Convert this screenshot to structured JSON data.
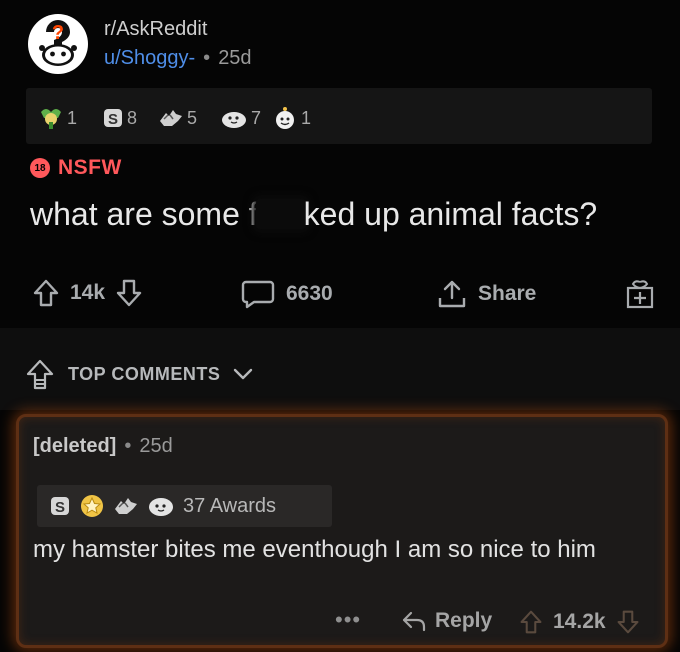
{
  "post": {
    "subreddit": "r/AskReddit",
    "author": "u/Shoggy-",
    "separator": "•",
    "age": "25d",
    "awards": [
      {
        "icon": "wholesome-award-icon",
        "count": "1"
      },
      {
        "icon": "silver-award-icon",
        "count": "8"
      },
      {
        "icon": "helpful-award-icon",
        "count": "5"
      },
      {
        "icon": "wholesome-seal-award-icon",
        "count": "7"
      },
      {
        "icon": "gold-smile-award-icon",
        "count": "1"
      }
    ],
    "nsfw_badge": "18",
    "nsfw_label": "NSFW",
    "title_start": "what are some f",
    "title_end": "ked up animal facts?",
    "upvotes": "14k",
    "comments": "6630",
    "share": "Share"
  },
  "sort": {
    "label": "TOP COMMENTS"
  },
  "comment": {
    "author": "[deleted]",
    "separator": "•",
    "age": "25d",
    "awards_label": "37 Awards",
    "body": "my hamster bites me eventhough I am so nice to him",
    "more": "•••",
    "reply": "Reply",
    "votes": "14.2k"
  },
  "colors": {
    "nsfw": "#ff585b",
    "username": "#4f8ee8",
    "comment_glow": "#d25a14"
  }
}
